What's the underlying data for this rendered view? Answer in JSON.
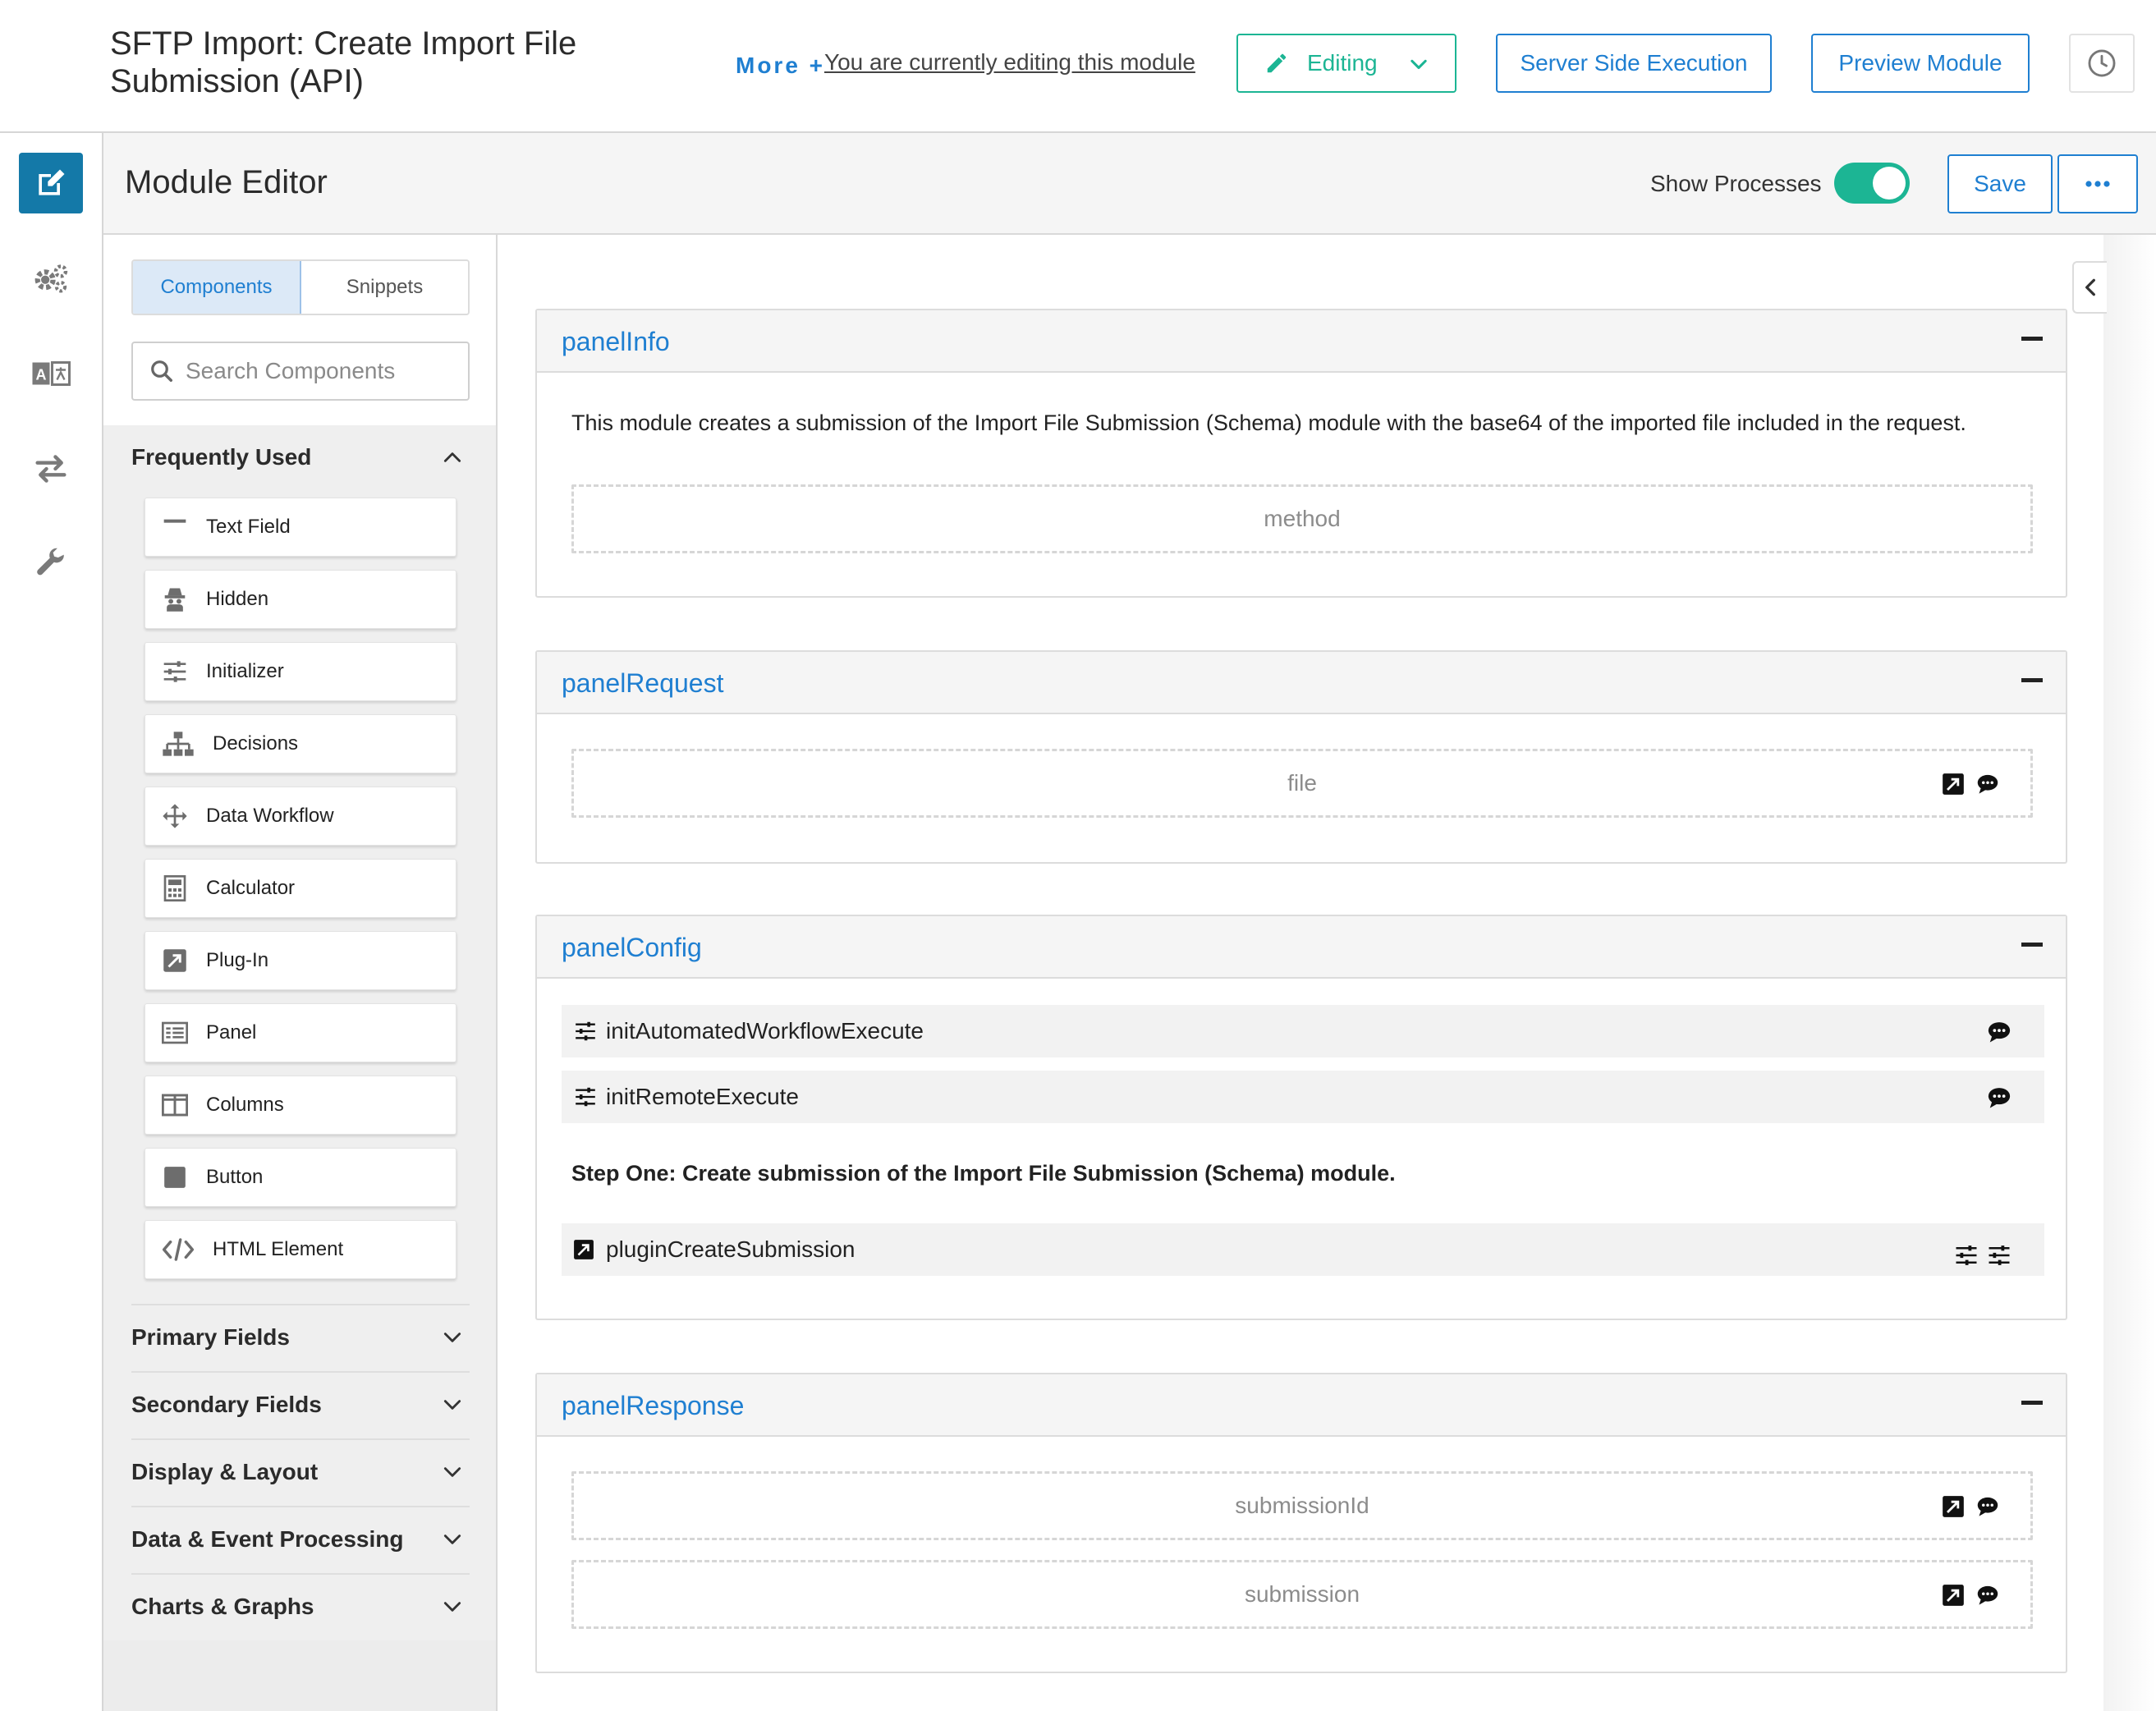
{
  "header": {
    "title": "SFTP Import: Create Import File Submission (API)",
    "more_label": "More +",
    "editing_note": "You are currently editing this module",
    "editing_label": "Editing",
    "server_side_label": "Server Side Execution",
    "preview_label": "Preview Module"
  },
  "editor": {
    "title": "Module Editor",
    "show_processes_label": "Show Processes",
    "show_processes_on": true,
    "save_label": "Save"
  },
  "sidebar": {
    "tabs": [
      {
        "label": "Components",
        "active": true
      },
      {
        "label": "Snippets",
        "active": false
      }
    ],
    "search_placeholder": "Search Components",
    "frequently_used": {
      "label": "Frequently Used",
      "expanded": true,
      "items": [
        {
          "label": "Text Field",
          "icon": "text-field-icon"
        },
        {
          "label": "Hidden",
          "icon": "hidden-icon"
        },
        {
          "label": "Initializer",
          "icon": "initializer-icon"
        },
        {
          "label": "Decisions",
          "icon": "decisions-icon"
        },
        {
          "label": "Data Workflow",
          "icon": "data-workflow-icon"
        },
        {
          "label": "Calculator",
          "icon": "calculator-icon"
        },
        {
          "label": "Plug-In",
          "icon": "plugin-icon"
        },
        {
          "label": "Panel",
          "icon": "panel-icon"
        },
        {
          "label": "Columns",
          "icon": "columns-icon"
        },
        {
          "label": "Button",
          "icon": "button-icon"
        },
        {
          "label": "HTML Element",
          "icon": "html-element-icon"
        }
      ]
    },
    "categories": [
      {
        "label": "Primary Fields"
      },
      {
        "label": "Secondary Fields"
      },
      {
        "label": "Display & Layout"
      },
      {
        "label": "Data & Event Processing"
      },
      {
        "label": "Charts & Graphs"
      }
    ]
  },
  "canvas": {
    "panels": [
      {
        "title": "panelInfo",
        "description": "This module creates a submission of the Import File Submission (Schema) module with the base64 of the imported file included in the request.",
        "fields": [
          "method"
        ]
      },
      {
        "title": "panelRequest",
        "fields": [
          "file"
        ]
      },
      {
        "title": "panelConfig",
        "rows": [
          "initAutomatedWorkflowExecute",
          "initRemoteExecute"
        ],
        "step_text": "Step One: Create submission of the Import File Submission (Schema) module.",
        "plugin_row": "pluginCreateSubmission"
      },
      {
        "title": "panelResponse",
        "fields": [
          "submissionId",
          "submission"
        ]
      }
    ]
  },
  "colors": {
    "accent_blue": "#1f7fd1",
    "accent_green": "#1cb594",
    "rail_active": "#1479a8"
  }
}
